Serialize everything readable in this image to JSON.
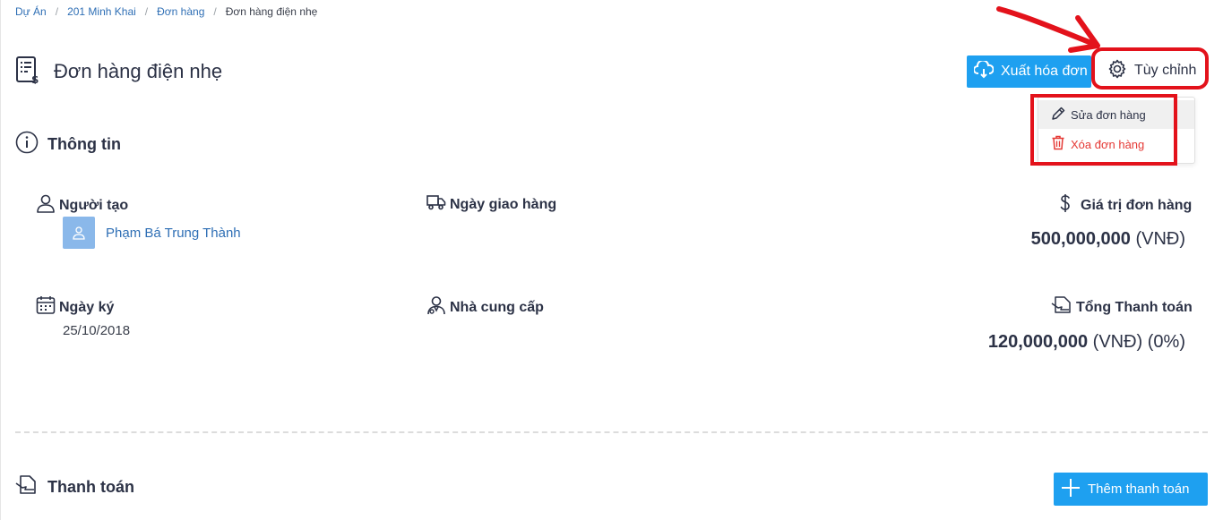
{
  "breadcrumb": {
    "items": [
      "Dự Án",
      "201 Minh Khai",
      "Đơn hàng"
    ],
    "current": "Đơn hàng điện nhẹ"
  },
  "header": {
    "title": "Đơn hàng điện nhẹ",
    "export_label": "Xuất hóa đơn",
    "custom_label": "Tùy chỉnh"
  },
  "dropdown": {
    "edit_label": "Sửa đơn hàng",
    "delete_label": "Xóa đơn hàng"
  },
  "info": {
    "title": "Thông tin",
    "creator_label": "Người tạo",
    "creator_name": "Phạm Bá Trung Thành",
    "delivery_label": "Ngày giao hàng",
    "value_label": "Giá trị đơn hàng",
    "value_amount": "500,000,000",
    "value_unit": "(VNĐ)",
    "signed_label": "Ngày ký",
    "signed_date": "25/10/2018",
    "supplier_label": "Nhà cung cấp",
    "total_label": "Tổng Thanh toán",
    "total_amount": "120,000,000",
    "total_unit": "(VNĐ) (0%)"
  },
  "payment": {
    "title": "Thanh toán",
    "add_label": "Thêm thanh toán"
  },
  "colors": {
    "primary": "#1ea0f0",
    "annotation": "#e3121b",
    "danger": "#e53935",
    "link": "#2f6fb5"
  }
}
